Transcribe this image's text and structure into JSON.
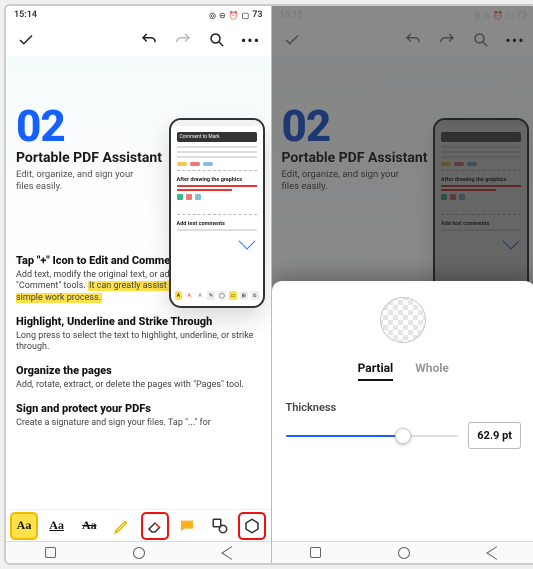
{
  "left": {
    "status": {
      "time": "15:14",
      "battery": "73"
    },
    "hero": {
      "num": "02",
      "title": "Portable PDF Assistant",
      "sub": "Edit, organize, and sign your files easily."
    },
    "mockup": {
      "bar": "Comment to Mark",
      "sec1": "After drawing the graphics",
      "sec2": "Add text comments"
    },
    "sections": {
      "s1h": "Tap \"+\" Icon to Edit and Comment",
      "s1p_a": "Add text, modify the original text, or add notes with \"Edit\" and \"Comment\" tools. ",
      "s1p_hl": "It can greatly assist in streamlining your simple work process.",
      "s2h": "Highlight, Underline and Strike Through",
      "s2p": "Long press to select the text to highlight, underline, or strike through.",
      "s3h": "Organize the pages",
      "s3p": "Add, rotate, extract, or delete the pages with \"Pages\" tool.",
      "s4h": "Sign and protect your PDFs",
      "s4p": "Create a signature and sign your files. Tap \"...\" for"
    },
    "tools": {
      "highlight": "Aa",
      "underline": "Aa",
      "strike": "Aa"
    }
  },
  "right": {
    "status": {
      "time": "15:15",
      "battery": "73"
    },
    "hero": {
      "num": "02",
      "title": "Portable PDF Assistant",
      "sub": "Edit, organize, and sign your files easily."
    },
    "mockup": {
      "bar": "",
      "sec1": "After drawing the graphics",
      "sec2": "Add text comments"
    },
    "sheet": {
      "tab_partial": "Partial",
      "tab_whole": "Whole",
      "thickness_label": "Thickness",
      "value": "62.9 pt"
    }
  }
}
